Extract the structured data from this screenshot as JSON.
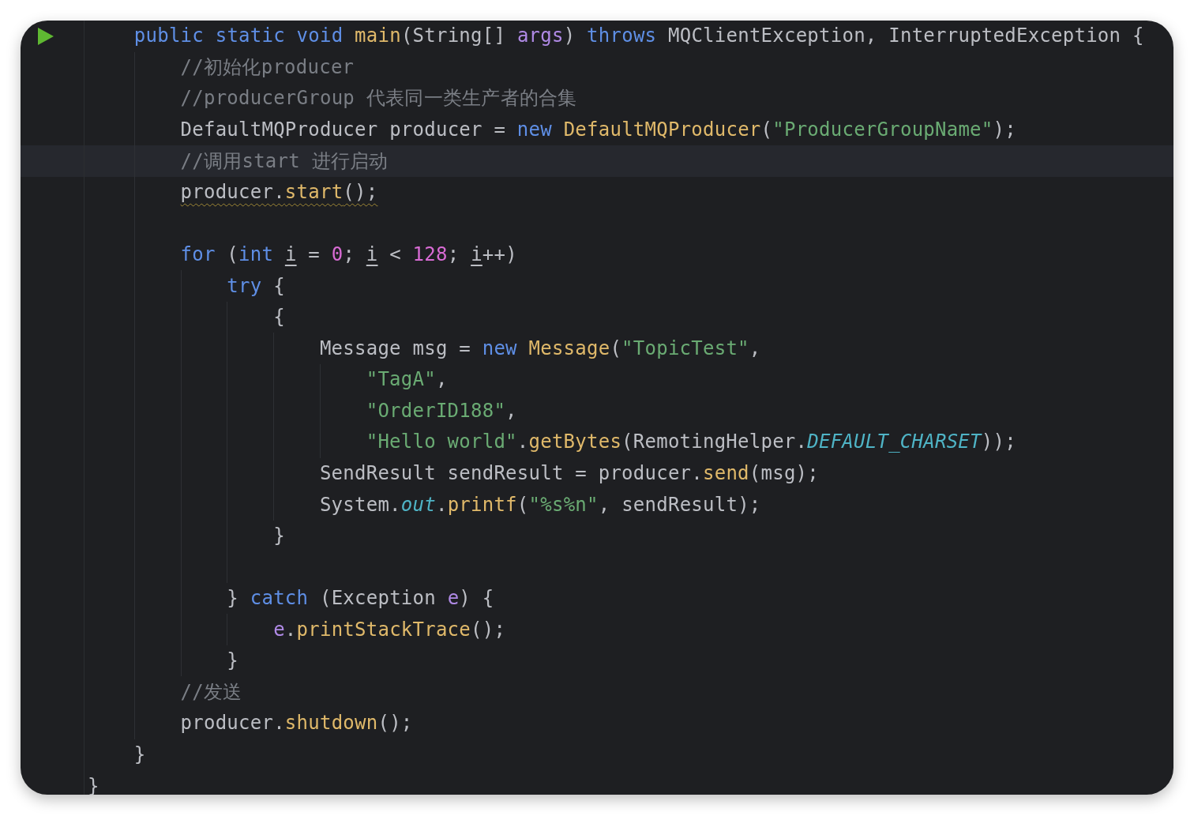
{
  "editor": {
    "lines": [
      {
        "kind": "code",
        "run_marker": true,
        "tokens": [
          {
            "kind": "kw",
            "text": "public static void "
          },
          {
            "kind": "method",
            "text": "main"
          },
          {
            "kind": "plain",
            "text": "(String[] "
          },
          {
            "kind": "param",
            "text": "args"
          },
          {
            "kind": "plain",
            "text": ") "
          },
          {
            "kind": "kw",
            "text": "throws"
          },
          {
            "kind": "plain",
            "text": " MQClientException, InterruptedException {"
          }
        ],
        "children": [
          {
            "kind": "code",
            "tokens": [
              {
                "kind": "comment",
                "text": "//初始化producer"
              }
            ]
          },
          {
            "kind": "code",
            "tokens": [
              {
                "kind": "comment",
                "text": "//producerGroup 代表同一类生产者的合集"
              }
            ]
          },
          {
            "kind": "code",
            "tokens": [
              {
                "kind": "plain",
                "text": "DefaultMQProducer producer = "
              },
              {
                "kind": "kw",
                "text": "new "
              },
              {
                "kind": "method",
                "text": "DefaultMQProducer"
              },
              {
                "kind": "plain",
                "text": "("
              },
              {
                "kind": "str",
                "text": "\"ProducerGroupName\""
              },
              {
                "kind": "plain",
                "text": ");"
              }
            ]
          },
          {
            "kind": "code",
            "current": true,
            "tokens": [
              {
                "kind": "comment",
                "text": "//调用start 进行启动"
              }
            ]
          },
          {
            "kind": "code",
            "warning": true,
            "tokens": [
              {
                "kind": "plain",
                "text": "producer."
              },
              {
                "kind": "method",
                "text": "start"
              },
              {
                "kind": "plain",
                "text": "();"
              }
            ]
          },
          {
            "kind": "blank"
          },
          {
            "kind": "code",
            "tokens": [
              {
                "kind": "kw",
                "text": "for"
              },
              {
                "kind": "plain",
                "text": " ("
              },
              {
                "kind": "kw",
                "text": "int "
              },
              {
                "kind": "var",
                "text": "i"
              },
              {
                "kind": "plain",
                "text": " = "
              },
              {
                "kind": "num",
                "text": "0"
              },
              {
                "kind": "plain",
                "text": "; "
              },
              {
                "kind": "var",
                "text": "i"
              },
              {
                "kind": "plain",
                "text": " < "
              },
              {
                "kind": "num",
                "text": "128"
              },
              {
                "kind": "plain",
                "text": "; "
              },
              {
                "kind": "var",
                "text": "i"
              },
              {
                "kind": "plain",
                "text": "++)"
              }
            ],
            "children": [
              {
                "kind": "code",
                "tokens": [
                  {
                    "kind": "kw",
                    "text": "try"
                  },
                  {
                    "kind": "plain",
                    "text": " {"
                  }
                ],
                "children": [
                  {
                    "kind": "code",
                    "tokens": [
                      {
                        "kind": "plain",
                        "text": "{"
                      }
                    ],
                    "children": [
                      {
                        "kind": "code",
                        "tokens": [
                          {
                            "kind": "plain",
                            "text": "Message msg = "
                          },
                          {
                            "kind": "kw",
                            "text": "new "
                          },
                          {
                            "kind": "method",
                            "text": "Message"
                          },
                          {
                            "kind": "plain",
                            "text": "("
                          },
                          {
                            "kind": "str",
                            "text": "\"TopicTest\""
                          },
                          {
                            "kind": "plain",
                            "text": ","
                          }
                        ],
                        "children": [
                          {
                            "kind": "code",
                            "tokens": [
                              {
                                "kind": "str",
                                "text": "\"TagA\""
                              },
                              {
                                "kind": "plain",
                                "text": ","
                              }
                            ]
                          },
                          {
                            "kind": "code",
                            "tokens": [
                              {
                                "kind": "str",
                                "text": "\"OrderID188\""
                              },
                              {
                                "kind": "plain",
                                "text": ","
                              }
                            ]
                          },
                          {
                            "kind": "code",
                            "tokens": [
                              {
                                "kind": "str",
                                "text": "\"Hello world\""
                              },
                              {
                                "kind": "plain",
                                "text": "."
                              },
                              {
                                "kind": "method",
                                "text": "getBytes"
                              },
                              {
                                "kind": "plain",
                                "text": "(RemotingHelper."
                              },
                              {
                                "kind": "field",
                                "text": "DEFAULT_CHARSET"
                              },
                              {
                                "kind": "plain",
                                "text": "));"
                              }
                            ]
                          }
                        ]
                      },
                      {
                        "kind": "code",
                        "tokens": [
                          {
                            "kind": "plain",
                            "text": "SendResult sendResult = producer."
                          },
                          {
                            "kind": "method",
                            "text": "send"
                          },
                          {
                            "kind": "plain",
                            "text": "(msg);"
                          }
                        ]
                      },
                      {
                        "kind": "code",
                        "tokens": [
                          {
                            "kind": "plain",
                            "text": "System."
                          },
                          {
                            "kind": "field",
                            "text": "out"
                          },
                          {
                            "kind": "plain",
                            "text": "."
                          },
                          {
                            "kind": "method",
                            "text": "printf"
                          },
                          {
                            "kind": "plain",
                            "text": "("
                          },
                          {
                            "kind": "str",
                            "text": "\"%s%n\""
                          },
                          {
                            "kind": "plain",
                            "text": ", sendResult);"
                          }
                        ]
                      }
                    ]
                  },
                  {
                    "kind": "code",
                    "tokens": [
                      {
                        "kind": "plain",
                        "text": "}"
                      }
                    ]
                  },
                  {
                    "kind": "blank"
                  }
                ]
              },
              {
                "kind": "code",
                "tokens": [
                  {
                    "kind": "plain",
                    "text": "} "
                  },
                  {
                    "kind": "kw",
                    "text": "catch"
                  },
                  {
                    "kind": "plain",
                    "text": " (Exception "
                  },
                  {
                    "kind": "param",
                    "text": "e"
                  },
                  {
                    "kind": "plain",
                    "text": ") {"
                  }
                ],
                "children": [
                  {
                    "kind": "code",
                    "tokens": [
                      {
                        "kind": "param",
                        "text": "e"
                      },
                      {
                        "kind": "plain",
                        "text": "."
                      },
                      {
                        "kind": "method",
                        "text": "printStackTrace"
                      },
                      {
                        "kind": "plain",
                        "text": "();"
                      }
                    ]
                  }
                ]
              },
              {
                "kind": "code",
                "tokens": [
                  {
                    "kind": "plain",
                    "text": "}"
                  }
                ]
              }
            ]
          },
          {
            "kind": "code",
            "tokens": [
              {
                "kind": "comment",
                "text": "//发送"
              }
            ]
          },
          {
            "kind": "code",
            "tokens": [
              {
                "kind": "plain",
                "text": "producer."
              },
              {
                "kind": "method",
                "text": "shutdown"
              },
              {
                "kind": "plain",
                "text": "();"
              }
            ]
          }
        ]
      },
      {
        "kind": "code",
        "tokens": [
          {
            "kind": "plain",
            "text": "}"
          }
        ]
      }
    ],
    "tail_lines": [
      {
        "kind": "code",
        "tokens": [
          {
            "kind": "plain",
            "text": "}"
          }
        ]
      }
    ]
  }
}
